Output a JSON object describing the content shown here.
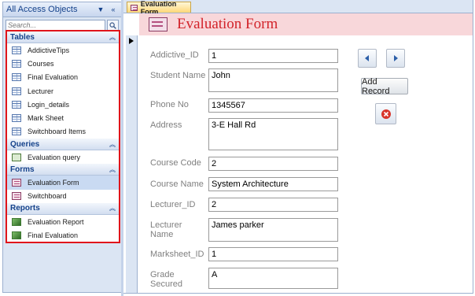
{
  "nav_pane": {
    "title": "All Access Objects",
    "search_placeholder": "Search...",
    "groups": [
      {
        "label": "Tables",
        "items": [
          "AddictiveTips",
          "Courses",
          "Final Evaluation",
          "Lecturer",
          "Login_details",
          "Mark Sheet",
          "Switchboard Items"
        ]
      },
      {
        "label": "Queries",
        "items": [
          "Evaluation query"
        ]
      },
      {
        "label": "Forms",
        "items": [
          "Evaluation Form",
          "Switchboard"
        ]
      },
      {
        "label": "Reports",
        "items": [
          "Evaluation Report",
          "Final Evaluation"
        ]
      }
    ],
    "selected_item": "Evaluation Form"
  },
  "document": {
    "tab_label": "Evaluation Form",
    "form_title": "Evaluation Form"
  },
  "fields": [
    {
      "label": "Addictive_ID",
      "value": "1"
    },
    {
      "label": "Student Name",
      "value": "John"
    },
    {
      "label": "Phone No",
      "value": "1345567"
    },
    {
      "label": "Address",
      "value": "3-E Hall Rd"
    },
    {
      "label": "Course Code",
      "value": "2"
    },
    {
      "label": "Course Name",
      "value": "System Architecture"
    },
    {
      "label": "Lecturer_ID",
      "value": "2"
    },
    {
      "label": "Lecturer Name",
      "value": "James parker"
    },
    {
      "label": "Marksheet_ID",
      "value": "1"
    },
    {
      "label": "Grade Secured",
      "value": "A"
    }
  ],
  "buttons": {
    "add_record": "Add Record"
  },
  "colors": {
    "highlight_border": "#e0151b",
    "form_title": "#d2232a",
    "header_band": "#f8d7da",
    "nav_blue": "#15428b"
  }
}
